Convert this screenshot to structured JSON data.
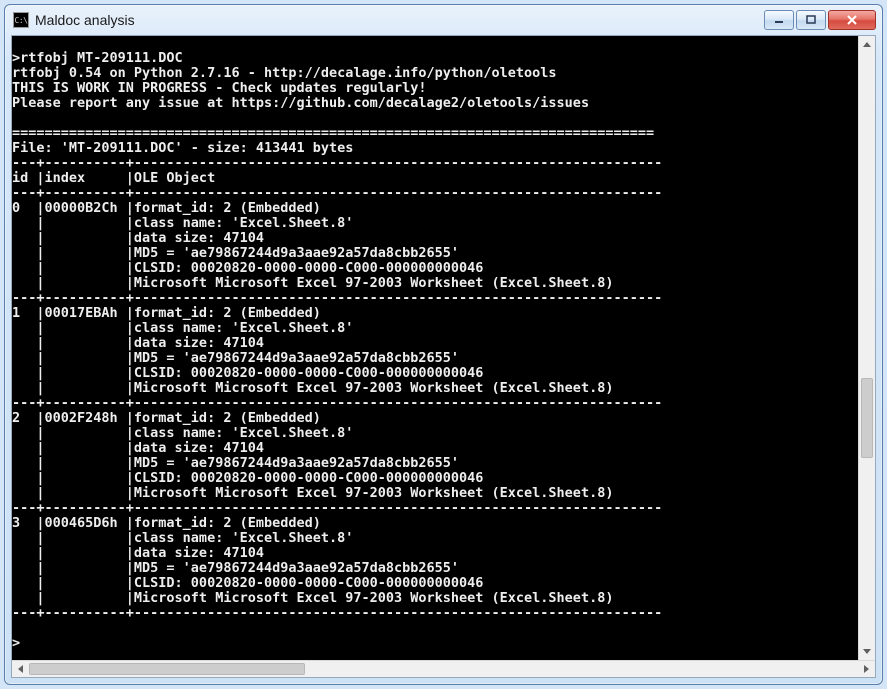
{
  "window": {
    "icon_text": "C:\\",
    "title": "Maldoc analysis"
  },
  "terminal": {
    "prompt": ">",
    "command": "rtfobj MT-209111.DOC",
    "header_lines": [
      "rtfobj 0.54 on Python 2.7.16 - http://decalage.info/python/oletools",
      "THIS IS WORK IN PROGRESS - Check updates regularly!",
      "Please report any issue at https://github.com/decalage2/oletools/issues"
    ],
    "rule_double": "===============================================================================",
    "file_line": "File: 'MT-209111.DOC' - size: 413441 bytes",
    "columns_line": "id |index     |OLE Object                                                       ",
    "row_sep": "---+----------+-----------------------------------------------------------------",
    "rows": [
      {
        "id": "0",
        "index": "00000B2Ch",
        "lines": [
          "format_id: 2 (Embedded)",
          "class name: 'Excel.Sheet.8'",
          "data size: 47104",
          "MD5 = 'ae79867244d9a3aae92a57da8cbb2655'",
          "CLSID: 00020820-0000-0000-C000-000000000046",
          "Microsoft Microsoft Excel 97-2003 Worksheet (Excel.Sheet.8)"
        ]
      },
      {
        "id": "1",
        "index": "00017EBAh",
        "lines": [
          "format_id: 2 (Embedded)",
          "class name: 'Excel.Sheet.8'",
          "data size: 47104",
          "MD5 = 'ae79867244d9a3aae92a57da8cbb2655'",
          "CLSID: 00020820-0000-0000-C000-000000000046",
          "Microsoft Microsoft Excel 97-2003 Worksheet (Excel.Sheet.8)"
        ]
      },
      {
        "id": "2",
        "index": "0002F248h",
        "lines": [
          "format_id: 2 (Embedded)",
          "class name: 'Excel.Sheet.8'",
          "data size: 47104",
          "MD5 = 'ae79867244d9a3aae92a57da8cbb2655'",
          "CLSID: 00020820-0000-0000-C000-000000000046",
          "Microsoft Microsoft Excel 97-2003 Worksheet (Excel.Sheet.8)"
        ]
      },
      {
        "id": "3",
        "index": "000465D6h",
        "lines": [
          "format_id: 2 (Embedded)",
          "class name: 'Excel.Sheet.8'",
          "data size: 47104",
          "MD5 = 'ae79867244d9a3aae92a57da8cbb2655'",
          "CLSID: 00020820-0000-0000-C000-000000000046",
          "Microsoft Microsoft Excel 97-2003 Worksheet (Excel.Sheet.8)"
        ]
      }
    ],
    "bottom_prompt": ">"
  }
}
